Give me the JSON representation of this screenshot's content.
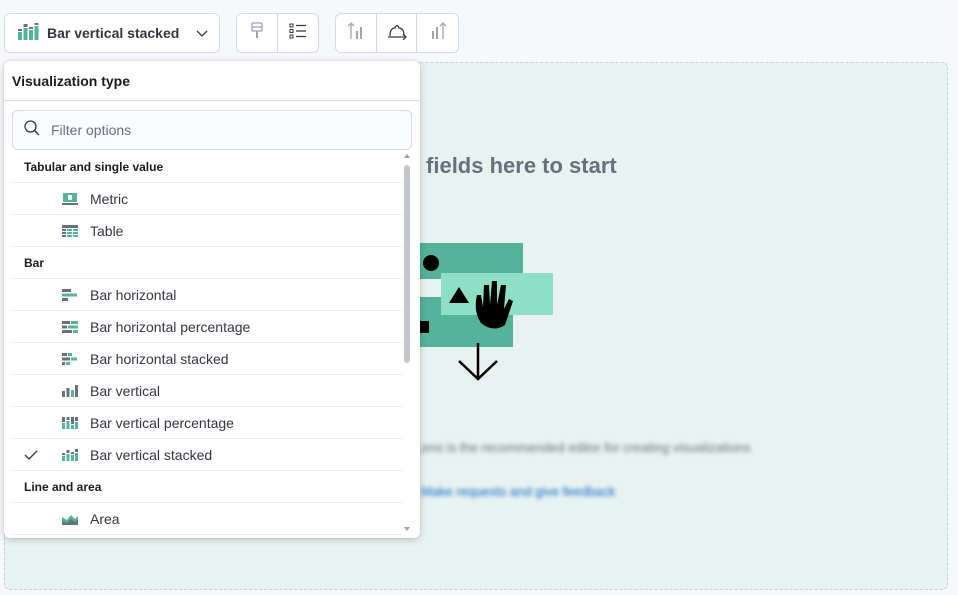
{
  "toolbar": {
    "viz_type_label": "Bar vertical stacked",
    "viz_icon": "bar-vertical-stacked-icon",
    "group1": [
      "paintbrush-icon",
      "list-settings-icon"
    ],
    "group2": [
      "left-axis-icon",
      "bottom-axis-icon",
      "right-axis-icon"
    ]
  },
  "workspace": {
    "drop_title": "Drop some fields here to start",
    "blurred_line1": "Lens is the recommended editor for creating visualizations",
    "blurred_line2": "Make requests and give feedback"
  },
  "popover": {
    "title": "Visualization type",
    "search_placeholder": "Filter options",
    "groups": [
      {
        "label": "Tabular and single value",
        "items": [
          {
            "label": "Metric",
            "icon": "metric-icon",
            "selected": false
          },
          {
            "label": "Table",
            "icon": "table-icon",
            "selected": false
          }
        ]
      },
      {
        "label": "Bar",
        "items": [
          {
            "label": "Bar horizontal",
            "icon": "bar-horizontal-icon",
            "selected": false
          },
          {
            "label": "Bar horizontal percentage",
            "icon": "bar-horizontal-percentage-icon",
            "selected": false
          },
          {
            "label": "Bar horizontal stacked",
            "icon": "bar-horizontal-stacked-icon",
            "selected": false
          },
          {
            "label": "Bar vertical",
            "icon": "bar-vertical-icon",
            "selected": false
          },
          {
            "label": "Bar vertical percentage",
            "icon": "bar-vertical-percentage-icon",
            "selected": false
          },
          {
            "label": "Bar vertical stacked",
            "icon": "bar-vertical-stacked-icon",
            "selected": true
          }
        ]
      },
      {
        "label": "Line and area",
        "items": [
          {
            "label": "Area",
            "icon": "area-chart-icon",
            "selected": false
          }
        ]
      }
    ]
  },
  "colors": {
    "accent_teal": "#54b399",
    "icon_gray": "#69707d",
    "workspace_bg": "#e8f2f1"
  }
}
